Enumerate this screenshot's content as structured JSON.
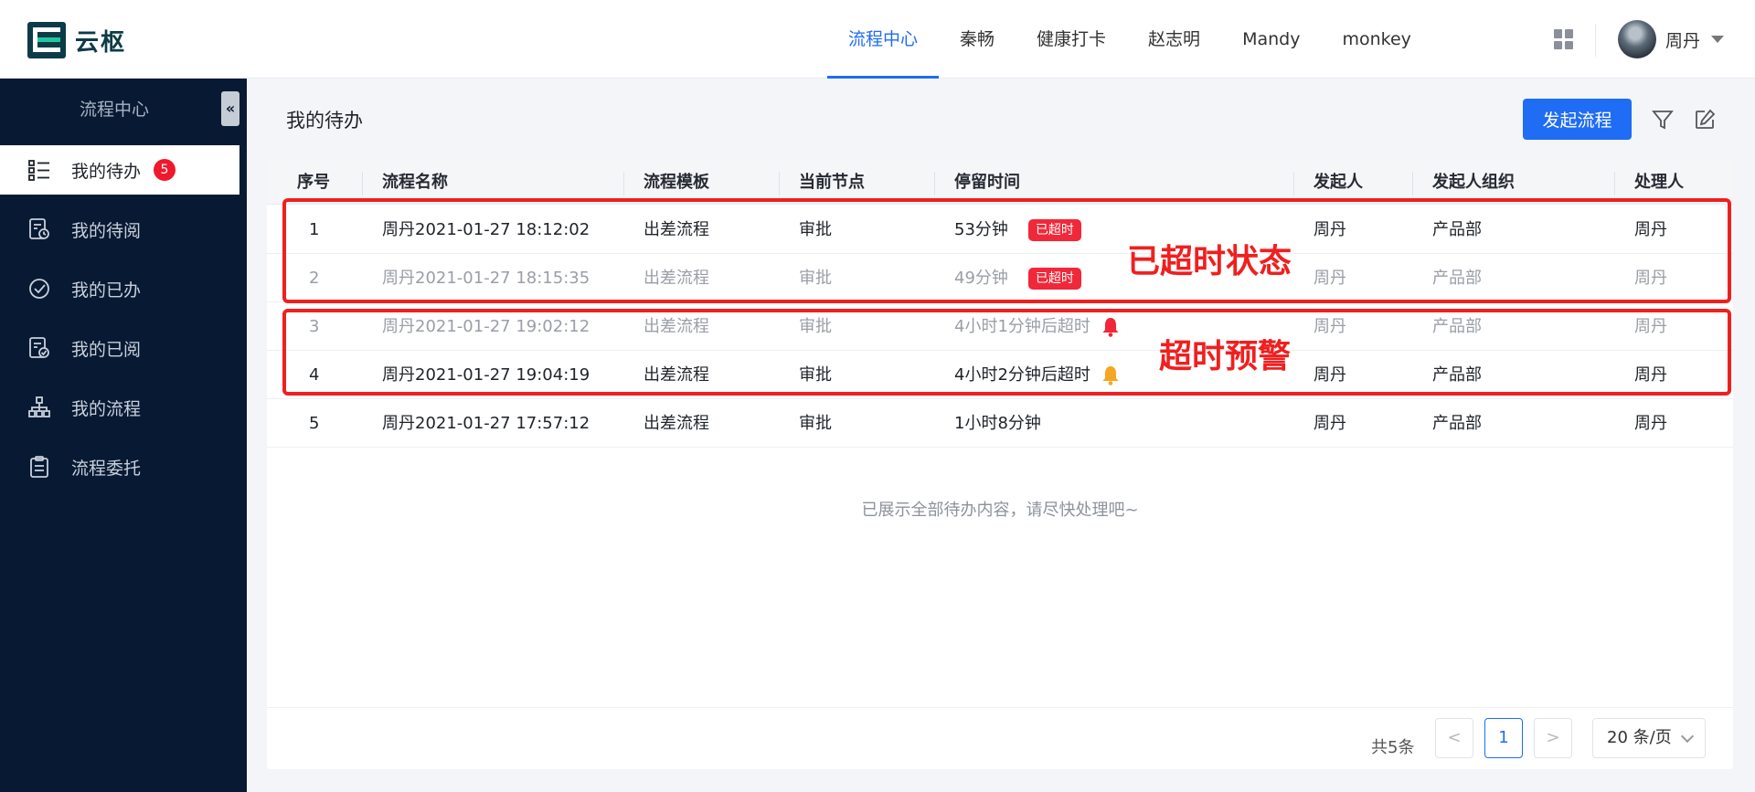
{
  "app": {
    "name": "云枢"
  },
  "header": {
    "nav": [
      {
        "label": "流程中心",
        "active": true
      },
      {
        "label": "秦畅"
      },
      {
        "label": "健康打卡"
      },
      {
        "label": "赵志明"
      },
      {
        "label": "Mandy"
      },
      {
        "label": "monkey"
      }
    ],
    "apps_icon": "grid-icon",
    "user": {
      "name": "周丹"
    }
  },
  "sidebar": {
    "title": "流程中心",
    "collapse_glyph": "«",
    "items": [
      {
        "label": "我的待办",
        "icon": "list-check-icon",
        "badge": "5",
        "active": true
      },
      {
        "label": "我的待阅",
        "icon": "doc-clock-icon"
      },
      {
        "label": "我的已办",
        "icon": "clock-check-icon"
      },
      {
        "label": "我的已阅",
        "icon": "doc-check-icon"
      },
      {
        "label": "我的流程",
        "icon": "org-tree-icon"
      },
      {
        "label": "流程委托",
        "icon": "clipboard-icon"
      }
    ]
  },
  "main": {
    "title": "我的待办",
    "start_button": "发起流程",
    "columns": [
      "序号",
      "流程名称",
      "流程模板",
      "当前节点",
      "停留时间",
      "发起人",
      "发起人组织",
      "处理人"
    ],
    "rows": [
      {
        "index": "1",
        "name": "周丹2021-01-27 18:12:02",
        "template": "出差流程",
        "node": "审批",
        "duration": "53分钟",
        "tag": "已超时",
        "initiator": "周丹",
        "org": "产品部",
        "handler": "周丹",
        "dim": false
      },
      {
        "index": "2",
        "name": "周丹2021-01-27 18:15:35",
        "template": "出差流程",
        "node": "审批",
        "duration": "49分钟",
        "tag": "已超时",
        "initiator": "周丹",
        "org": "产品部",
        "handler": "周丹",
        "dim": true
      },
      {
        "index": "3",
        "name": "周丹2021-01-27 19:02:12",
        "template": "出差流程",
        "node": "审批",
        "duration": "4小时1分钟后超时",
        "bell_color": "#f0283a",
        "initiator": "周丹",
        "org": "产品部",
        "handler": "周丹",
        "dim": true
      },
      {
        "index": "4",
        "name": "周丹2021-01-27 19:04:19",
        "template": "出差流程",
        "node": "审批",
        "duration": "4小时2分钟后超时",
        "bell_color": "#f5a623",
        "initiator": "周丹",
        "org": "产品部",
        "handler": "周丹",
        "dim": false
      },
      {
        "index": "5",
        "name": "周丹2021-01-27 17:57:12",
        "template": "出差流程",
        "node": "审批",
        "duration": "1小时8分钟",
        "initiator": "周丹",
        "org": "产品部",
        "handler": "周丹",
        "dim": false
      }
    ],
    "empty_note": "已展示全部待办内容，请尽快处理吧~",
    "pagination": {
      "total": "共5条",
      "prev": "<",
      "current": "1",
      "next": ">",
      "page_size": "20 条/页"
    }
  },
  "annotations": [
    {
      "label": "已超时状态"
    },
    {
      "label": "超时预警"
    }
  ],
  "colors": {
    "accent": "#1f6cf5",
    "sidebar_bg": "#081a33",
    "danger": "#f0283a",
    "warning": "#f5a623",
    "annotation": "#f01f1f"
  }
}
